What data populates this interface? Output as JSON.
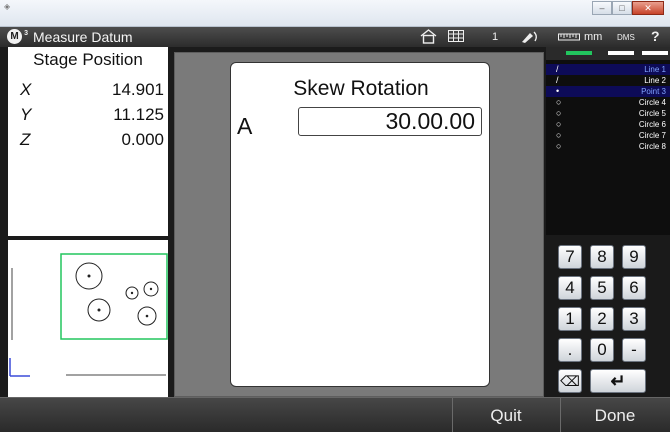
{
  "window": {
    "minimize": "–",
    "maximize": "□",
    "close": "✕"
  },
  "app": {
    "logo_letter": "M",
    "logo_sup": "3",
    "title": "Measure Datum",
    "toolbar": {
      "home_icon": "home-icon",
      "grid_icon": "grid-icon",
      "count": "1",
      "probe_icon": "probe-icon",
      "units": "mm",
      "angle_mode": "DMS",
      "help": "?"
    }
  },
  "stage": {
    "title": "Stage Position",
    "axes": [
      {
        "label": "X",
        "value": "14.901"
      },
      {
        "label": "Y",
        "value": "11.125"
      },
      {
        "label": "Z",
        "value": "0.000"
      }
    ]
  },
  "dialog": {
    "title": "Skew Rotation",
    "axis_label": "A",
    "value": "30.00.00"
  },
  "features": {
    "tab_colors": [
      "#22c55e",
      "#ffffff",
      "#ffffff"
    ],
    "items": [
      {
        "icon": "/",
        "name": "Line 1",
        "selected": true
      },
      {
        "icon": "/",
        "name": "Line 2",
        "selected": false
      },
      {
        "icon": "•",
        "name": "Point 3",
        "selected": true
      },
      {
        "icon": "○",
        "name": "Circle 4",
        "selected": false
      },
      {
        "icon": "○",
        "name": "Circle 5",
        "selected": false
      },
      {
        "icon": "○",
        "name": "Circle 6",
        "selected": false
      },
      {
        "icon": "○",
        "name": "Circle 7",
        "selected": false
      },
      {
        "icon": "○",
        "name": "Circle 8",
        "selected": false
      }
    ]
  },
  "keypad": {
    "keys": [
      "7",
      "8",
      "9",
      "4",
      "5",
      "6",
      "1",
      "2",
      "3",
      ".",
      "0",
      "-"
    ],
    "backspace": "⌫",
    "enter": "↵"
  },
  "bottom": {
    "quit": "Quit",
    "done": "Done"
  },
  "colors": {
    "accent_green": "#22c55e",
    "selection_blue": "#0d0b58"
  }
}
